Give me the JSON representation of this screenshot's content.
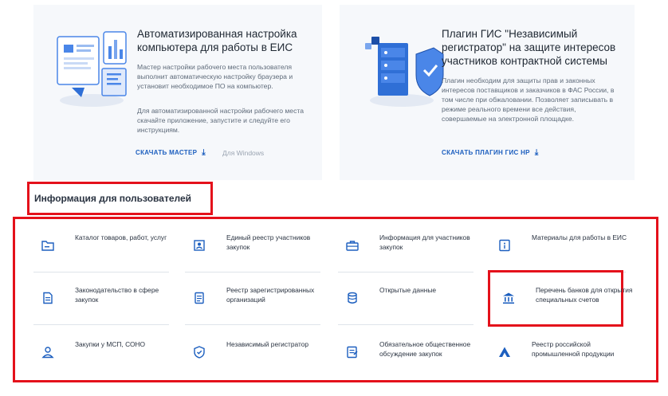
{
  "master_card": {
    "title": "Автоматизированная настройка компьютера для работы в ЕИС",
    "desc1": "Мастер настройки рабочего места пользователя выполнит автоматическую настройку браузера и установит необходимое ПО на компьютер.",
    "desc2": "Для автоматизированной настройки рабочего места скачайте приложение, запустите и следуйте его инструкциям.",
    "download_label": "СКАЧАТЬ МАСТЕР",
    "platform": "Для Windows"
  },
  "plugin_card": {
    "title": "Плагин ГИС \"Независимый регистратор\" на защите интересов участников контрактной системы",
    "desc1": "Плагин необходим для защиты прав и законных интересов поставщиков и заказчиков в ФАС России, в том числе при обжаловании. Позволяет записывать в режиме реального времени все действия, совершаемые на электронной площадке.",
    "download_label": "СКАЧАТЬ ПЛАГИН ГИС НР"
  },
  "info_section": {
    "title": "Информация для пользователей",
    "items": [
      {
        "label": "Каталог товаров, работ, услуг",
        "icon": "folder-icon"
      },
      {
        "label": "Единый реестр участников закупок",
        "icon": "registry-user-icon"
      },
      {
        "label": "Информация для участников закупок",
        "icon": "briefcase-icon"
      },
      {
        "label": "Материалы для работы в ЕИС",
        "icon": "info-document-icon"
      },
      {
        "label": "Законодательство в сфере закупок",
        "icon": "law-document-icon"
      },
      {
        "label": "Реестр зарегистрированных организаций",
        "icon": "organization-registry-icon"
      },
      {
        "label": "Открытые данные",
        "icon": "database-icon"
      },
      {
        "label": "Перечень банков для открытия специальных счетов",
        "icon": "bank-icon"
      },
      {
        "label": "Закупки у МСП, СОНО",
        "icon": "person-icon"
      },
      {
        "label": "Независимый регистратор",
        "icon": "shield-icon"
      },
      {
        "label": "Обязательное общественное обсуждение закупок",
        "icon": "discussion-document-icon"
      },
      {
        "label": "Реестр российской промышленной продукции",
        "icon": "industry-logo-icon"
      }
    ]
  },
  "colors": {
    "accent": "#1d5fbf",
    "highlight": "#e4111b",
    "card_bg": "#f6f8fb"
  }
}
